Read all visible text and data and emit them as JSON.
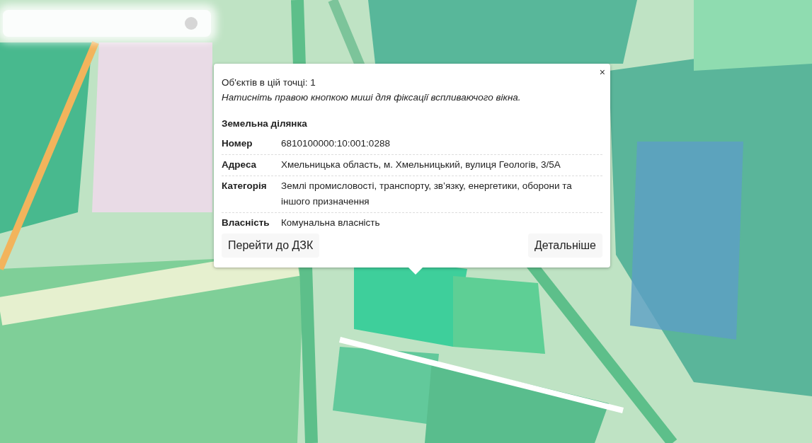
{
  "popup": {
    "close": "×",
    "count_text": "Об'єктів в цій точці: 1",
    "hint": "Натисніть правою кнопкою миші для фіксації вспливаючого вікна.",
    "section_title": "Земельна ділянка",
    "fields": [
      {
        "label": "Номер",
        "value": "6810100000:10:001:0288"
      },
      {
        "label": "Адреса",
        "value": "Хмельницька область, м. Хмельницький, вулиця Геологів, 3/5А"
      },
      {
        "label": "Категорія",
        "value": "Землі промисловості, транспорту, зв’язку, енергетики, оборони та іншого призначення"
      },
      {
        "label": "Власність",
        "value": "Комунальна власність"
      }
    ],
    "buttons": [
      "Перейти до ДЗК",
      "Детальніше"
    ]
  }
}
